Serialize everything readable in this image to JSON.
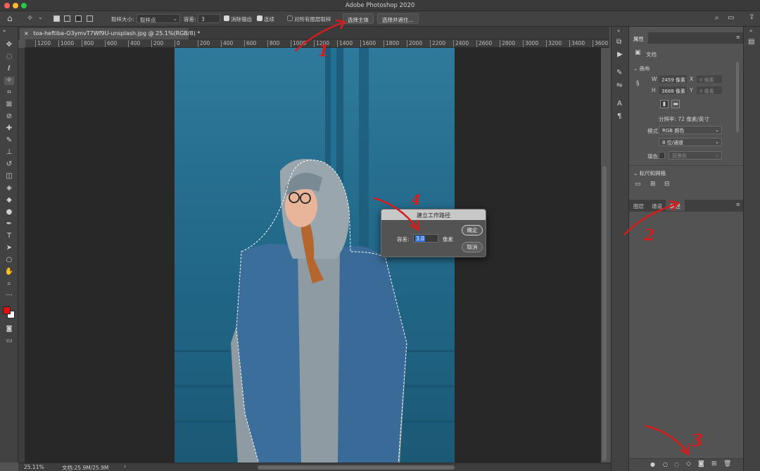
{
  "window": {
    "title": "Adobe Photoshop 2020"
  },
  "options_bar": {
    "sample_size_label": "取样大小:",
    "sample_size_value": "取样点",
    "tolerance_label": "容差:",
    "tolerance_value": "3",
    "anti_alias_label": "消除锯齿",
    "anti_alias_checked": true,
    "contiguous_label": "连续",
    "contiguous_checked": true,
    "sample_all_layers_label": "对所有图层取样",
    "sample_all_layers_checked": false,
    "select_subject_label": "选择主体",
    "select_and_mask_label": "选择并遮住..."
  },
  "document_tab": {
    "label": "toa-heftiba-O3ymvT7Wf9U-unsplash.jpg @ 25.1%(RGB/8) *"
  },
  "ruler": {
    "ticks": [
      "1200",
      "1000",
      "800",
      "600",
      "400",
      "200",
      "0",
      "200",
      "400",
      "600",
      "800",
      "1000",
      "1200",
      "1400",
      "1600",
      "1800",
      "2000",
      "2200",
      "2400",
      "2600",
      "2800",
      "3000",
      "3200",
      "3400",
      "3600"
    ]
  },
  "dialog": {
    "title": "建立工作路径",
    "tolerance_label": "容差:",
    "tolerance_value": "3.0",
    "unit": "像素",
    "ok_label": "确定",
    "cancel_label": "取消"
  },
  "properties_panel": {
    "tab_label": "属性",
    "doc_label": "文档",
    "canvas_section": "画布",
    "w_label": "W",
    "w_value": "2459 像素",
    "h_label": "H",
    "h_value": "3688 像素",
    "x_label": "X",
    "x_placeholder": "0 像素",
    "y_label": "Y",
    "y_placeholder": "0 像素",
    "resolution": "分辨率: 72 像素/英寸",
    "mode_label": "模式",
    "mode_value": "RGB 颜色",
    "depth_value": "8 位/通道",
    "fill_label": "填色",
    "fill_value": "背景色",
    "rulers_section": "标尺和网格"
  },
  "layers_panel": {
    "tabs": [
      "图层",
      "通道",
      "路径"
    ],
    "active_tab": 2
  },
  "status_bar": {
    "zoom": "25.11%",
    "doc_size": "文档:25.9M/25.9M"
  },
  "annotations": [
    "1",
    "2",
    "3",
    "4"
  ],
  "colors": {
    "foreground": "#e01010",
    "background": "#ffffff",
    "accent": "#2f7a9c",
    "annotation": "#d41d1d"
  }
}
